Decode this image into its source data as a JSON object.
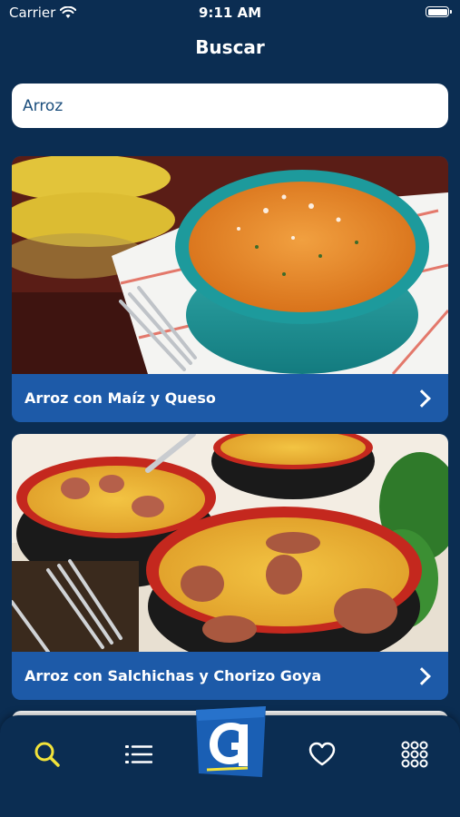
{
  "status_bar": {
    "carrier": "Carrier",
    "time": "9:11 AM"
  },
  "header": {
    "title": "Buscar"
  },
  "search": {
    "value": "Arroz"
  },
  "results": [
    {
      "title": "Arroz con Maíz y Queso"
    },
    {
      "title": "Arroz con Salchichas y Chorizo Goya"
    }
  ],
  "tab_bar": {
    "active_tab": "search",
    "active_color": "#f2e33a",
    "inactive_color": "#ffffff",
    "icons": [
      "search-icon",
      "list-icon",
      "goya-logo",
      "heart-icon",
      "grid-icon"
    ]
  },
  "colors": {
    "background": "#0b2d52",
    "card_footer": "#1d5aa8",
    "search_text": "#1c4f7d"
  }
}
